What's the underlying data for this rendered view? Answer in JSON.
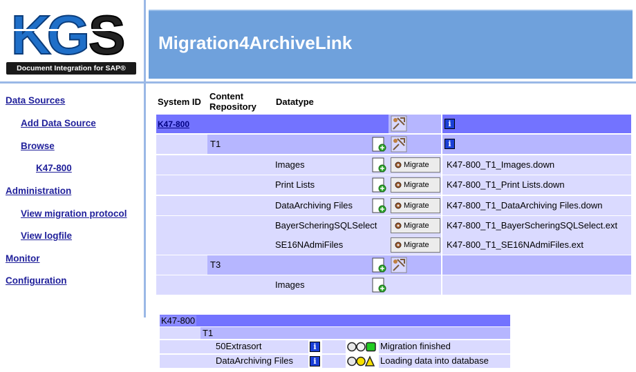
{
  "header": {
    "logo_text": "KGS",
    "logo_subtitle": "Document Integration for SAP®",
    "title": "Migration4ArchiveLink"
  },
  "nav": {
    "data_sources": "Data Sources",
    "add_data_source": "Add Data Source",
    "browse": "Browse",
    "k47": "K47-800",
    "administration": "Administration",
    "view_migration_protocol": "View migration protocol",
    "view_logfile": "View logfile",
    "monitor": "Monitor",
    "configuration": "Configuration"
  },
  "table": {
    "headers": {
      "system_id": "System ID",
      "content_repo": "Content Repository",
      "datatype": "Datatype"
    },
    "system": {
      "id": "K47-800"
    },
    "repositories": [
      {
        "name": "T1"
      },
      {
        "name": "T3"
      }
    ],
    "rows": [
      {
        "datatype": "Images",
        "migrate": "Migrate",
        "file": "K47-800_T1_Images.down"
      },
      {
        "datatype": "Print Lists",
        "migrate": "Migrate",
        "file": "K47-800_T1_Print Lists.down"
      },
      {
        "datatype": "DataArchiving Files",
        "migrate": "Migrate",
        "file": "K47-800_T1_DataArchiving Files.down"
      },
      {
        "datatype": "BayerScheringSQLSelect",
        "migrate": "Migrate",
        "file": "K47-800_T1_BayerScheringSQLSelect.ext"
      },
      {
        "datatype": "SE16NAdmiFiles",
        "migrate": "Migrate",
        "file": "K47-800_T1_SE16NAdmiFiles.ext"
      },
      {
        "datatype": "Images"
      }
    ]
  },
  "status": {
    "system": "K47-800",
    "repository": "T1",
    "rows": [
      {
        "name": "50Extrasort",
        "status": "Migration finished",
        "lights": "green"
      },
      {
        "name": "DataArchiving Files",
        "status": "Loading data into database",
        "lights": "yellow"
      }
    ]
  },
  "colors": {
    "banner": "#6fa1dc",
    "row_dark": "#7373ff",
    "row_mid": "#b6b6ff",
    "row_light": "#dadaff",
    "nav_link": "#1f1f9a"
  }
}
